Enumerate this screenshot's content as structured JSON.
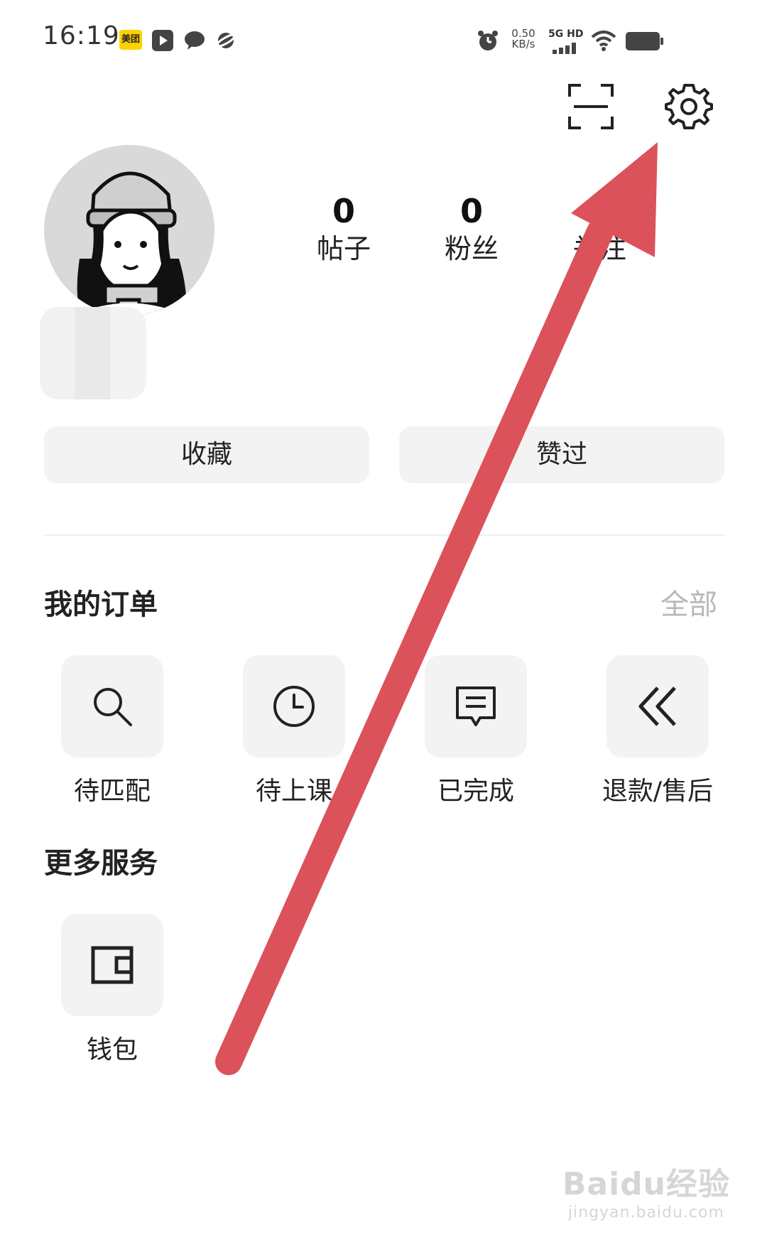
{
  "status_bar": {
    "time": "16:19",
    "meituan_label": "美团",
    "net_speed_value": "0.50",
    "net_speed_unit": "KB/s",
    "net_type": "5G HD"
  },
  "profile": {
    "stats": [
      {
        "value": "0",
        "label": "帖子"
      },
      {
        "value": "0",
        "label": "粉丝"
      },
      {
        "value": "",
        "label": "关注"
      }
    ]
  },
  "actions": {
    "favorites": "收藏",
    "liked": "赞过"
  },
  "orders": {
    "title": "我的订单",
    "all": "全部",
    "items": [
      {
        "label": "待匹配",
        "icon": "search-icon"
      },
      {
        "label": "待上课",
        "icon": "clock-icon"
      },
      {
        "label": "已完成",
        "icon": "message-icon"
      },
      {
        "label": "退款/售后",
        "icon": "double-chevron-left-icon"
      }
    ]
  },
  "services": {
    "title": "更多服务",
    "items": [
      {
        "label": "钱包",
        "icon": "wallet-icon"
      }
    ]
  },
  "overlay": {
    "arrow_color": "#db525a",
    "watermark_main": "Baidu经验",
    "watermark_sub": "jingyan.baidu.com"
  }
}
